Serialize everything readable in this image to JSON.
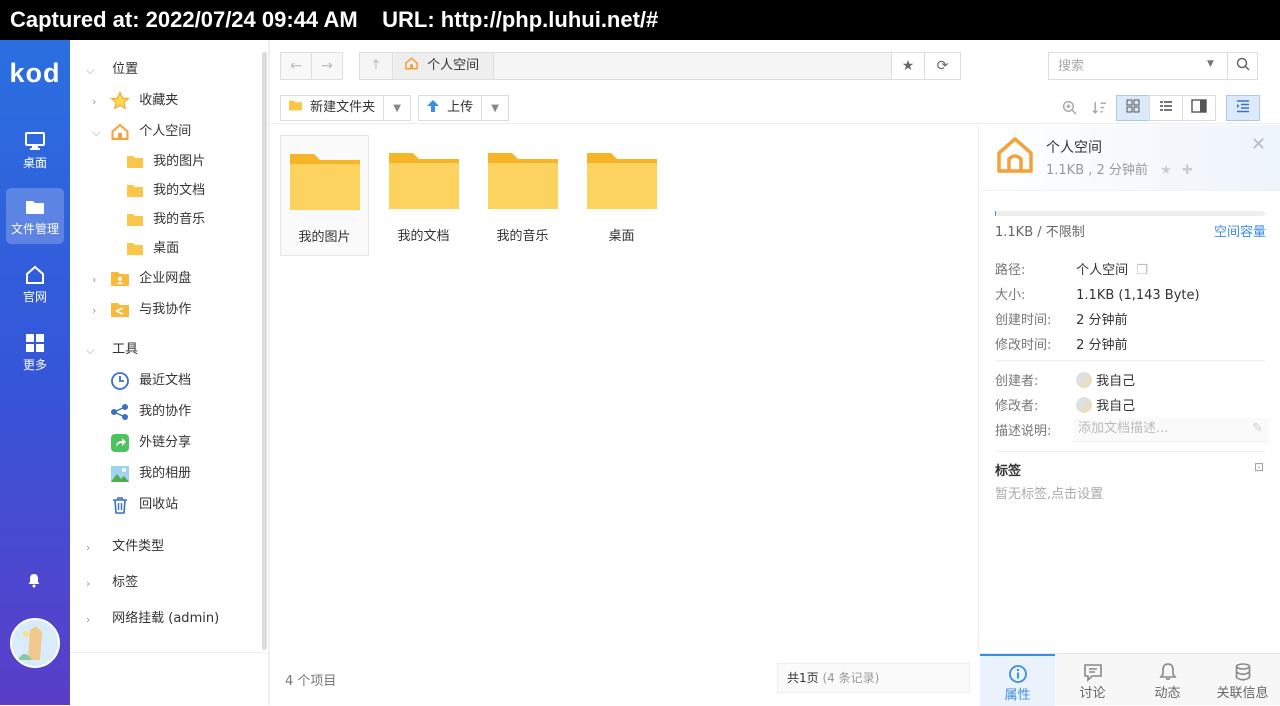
{
  "capture": {
    "text": "Captured at: 2022/07/24 09:44 AM    URL: http://php.luhui.net/#"
  },
  "rail": {
    "logo": "kod",
    "items": [
      {
        "label": "桌面"
      },
      {
        "label": "文件管理"
      },
      {
        "label": "官网"
      },
      {
        "label": "更多"
      }
    ]
  },
  "tree": {
    "location": "位置",
    "favorites": "收藏夹",
    "personal": "个人空间",
    "children": [
      "我的图片",
      "我的文档",
      "我的音乐",
      "桌面"
    ],
    "enterprise": "企业网盘",
    "shared": "与我协作",
    "tools": "工具",
    "recent": "最近文档",
    "collab": "我的协作",
    "links": "外链分享",
    "album": "我的相册",
    "recycle": "回收站",
    "filetypes": "文件类型",
    "tags": "标签",
    "mounts": "网络挂载 (admin)"
  },
  "nav": {
    "crumb": "个人空间",
    "search_placeholder": "搜索"
  },
  "toolbar": {
    "new_folder": "新建文件夹",
    "upload": "上传"
  },
  "files": [
    {
      "name": "我的图片"
    },
    {
      "name": "我的文档"
    },
    {
      "name": "我的音乐"
    },
    {
      "name": "桌面"
    }
  ],
  "status": {
    "count": "4 个项目",
    "pager_main": "共1页",
    "pager_muted": "(4 条记录)"
  },
  "panel": {
    "title": "个人空间",
    "subtitle": "1.1KB , 2 分钟前",
    "quota_text": "1.1KB / 不限制",
    "quota_link": "空间容量",
    "quota_used_fraction": 0.005,
    "props": {
      "path_k": "路径:",
      "path_v": "个人空间",
      "size_k": "大小:",
      "size_v": "1.1KB (1,143 Byte)",
      "created_k": "创建时间:",
      "created_v": "2 分钟前",
      "modified_k": "修改时间:",
      "modified_v": "2 分钟前",
      "creator_k": "创建者:",
      "creator_v": "我自己",
      "modifier_k": "修改者:",
      "modifier_v": "我自己",
      "desc_k": "描述说明:",
      "desc_placeholder": "添加文档描述..."
    },
    "tags_title": "标签",
    "tags_empty": "暂无标签,点击设置",
    "tabs": [
      {
        "label": "属性"
      },
      {
        "label": "讨论"
      },
      {
        "label": "动态"
      },
      {
        "label": "关联信息"
      }
    ]
  },
  "colors": {
    "accent": "#3a8ee6",
    "rail_top": "#2a6fe0",
    "rail_bottom": "#5a3ec8",
    "folder": "#f9c64a"
  }
}
